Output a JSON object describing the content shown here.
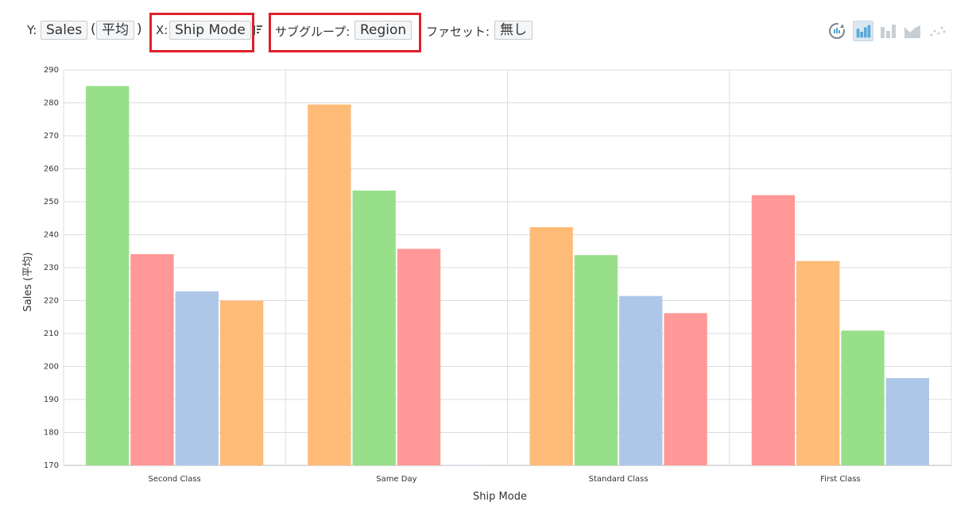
{
  "toolbar": {
    "y_label": "Y:",
    "y_value": "Sales",
    "y_agg": "平均",
    "open_paren": "(",
    "close_paren": ")",
    "x_label": "X:",
    "x_value": "Ship Mode",
    "subgroup_label": "サブグループ:",
    "subgroup_value": "Region",
    "facet_label": "ファセット:",
    "facet_value": "無し",
    "icons": [
      "refresh-icon",
      "bar-chart-icon",
      "stacked-bar-icon",
      "area-chart-icon",
      "scatter-icon"
    ]
  },
  "colors": {
    "series": [
      "#98df8a",
      "#ff9896",
      "#aec7e8",
      "#ffbb78"
    ],
    "highlight": "#e0202c",
    "grid": "#dddddd"
  },
  "chart_data": {
    "type": "bar",
    "xlabel": "Ship Mode",
    "ylabel": "Sales (平均)",
    "ylim": [
      170,
      290
    ],
    "yticks": [
      170,
      180,
      190,
      200,
      210,
      220,
      230,
      240,
      250,
      260,
      270,
      280,
      290
    ],
    "grid": true,
    "categories": [
      "Second Class",
      "Same Day",
      "Standard Class",
      "First Class"
    ],
    "groups": [
      {
        "category": "Second Class",
        "bars": [
          {
            "color": "#98df8a",
            "value": 285.1
          },
          {
            "color": "#ff9896",
            "value": 234.1
          },
          {
            "color": "#aec7e8",
            "value": 222.8
          },
          {
            "color": "#ffbb78",
            "value": 220.0
          }
        ]
      },
      {
        "category": "Same Day",
        "bars": [
          {
            "color": "#ffbb78",
            "value": 279.5
          },
          {
            "color": "#98df8a",
            "value": 253.4
          },
          {
            "color": "#ff9896",
            "value": 235.7
          },
          {
            "color": "#aec7e8",
            "value": 170.1
          }
        ]
      },
      {
        "category": "Standard Class",
        "bars": [
          {
            "color": "#ffbb78",
            "value": 242.3
          },
          {
            "color": "#98df8a",
            "value": 233.8
          },
          {
            "color": "#aec7e8",
            "value": 221.4
          },
          {
            "color": "#ff9896",
            "value": 216.2
          }
        ]
      },
      {
        "category": "First Class",
        "bars": [
          {
            "color": "#ff9896",
            "value": 252.0
          },
          {
            "color": "#ffbb78",
            "value": 232.0
          },
          {
            "color": "#98df8a",
            "value": 210.9
          },
          {
            "color": "#aec7e8",
            "value": 196.5
          }
        ]
      }
    ]
  }
}
